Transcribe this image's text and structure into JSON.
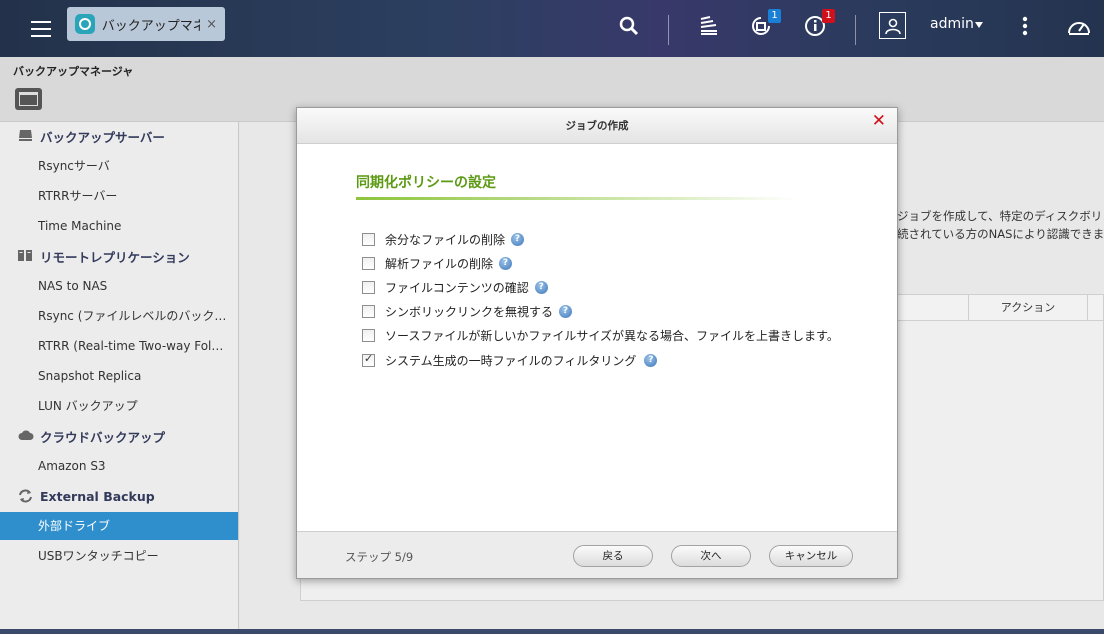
{
  "topbar": {
    "tab_label": "バックアップマネ...",
    "tab_close": "×",
    "notif_badge_1": "1",
    "notif_badge_2": "1",
    "user": "admin",
    "badge_color_blue": "#1a7fd6",
    "badge_color_red": "#d0101a",
    "icons": [
      "menu-icon",
      "app-icon",
      "search-icon",
      "stack-icon",
      "notification-icon",
      "info-icon",
      "user-icon",
      "more-icon",
      "dashboard-icon"
    ]
  },
  "app": {
    "title": "バックアップマネージャ"
  },
  "sidebar": {
    "sections": [
      {
        "label": "バックアップサーバー",
        "icon": "server-icon"
      },
      {
        "label": "リモートレプリケーション",
        "icon": "replication-icon"
      },
      {
        "label": "クラウドバックアップ",
        "icon": "cloud-icon"
      },
      {
        "label": "External Backup",
        "icon": "sync-icon"
      }
    ],
    "items": [
      "Rsyncサーバ",
      "RTRRサーバー",
      "Time Machine",
      "NAS to NAS",
      "Rsync (ファイルレベルのバックアップ)",
      "RTRR (Real-time Two-way Folder Sync)",
      "Snapshot Replica",
      "LUN バックアップ",
      "Amazon S3",
      "外部ドライブ",
      "USBワンタッチコピー"
    ],
    "active_color": "#2f8fcd"
  },
  "content": {
    "text_line_1": "ジョブを作成して、特定のディスクボリュー",
    "text_line_2": "続されている方のNASにより認識できます",
    "column_action": "アクション"
  },
  "modal": {
    "title": "ジョブの作成",
    "close": "✕",
    "section_title": "同期化ポリシーの設定",
    "section_color": "#5c9a14",
    "options": [
      {
        "label": "余分なファイルの削除",
        "checked": false,
        "help": true
      },
      {
        "label": "解析ファイルの削除",
        "checked": false,
        "help": true
      },
      {
        "label": "ファイルコンテンツの確認",
        "checked": false,
        "help": true
      },
      {
        "label": "シンボリックリンクを無視する",
        "checked": false,
        "help": true
      },
      {
        "label": "ソースファイルが新しいかファイルサイズが異なる場合、ファイルを上書きします。",
        "checked": false,
        "help": false
      },
      {
        "label": "システム生成の一時ファイルのフィルタリング",
        "checked": true,
        "help": true
      }
    ],
    "step": "ステップ 5/9",
    "back_label": "戻る",
    "next_label": "次へ",
    "cancel_label": "キャンセル"
  }
}
